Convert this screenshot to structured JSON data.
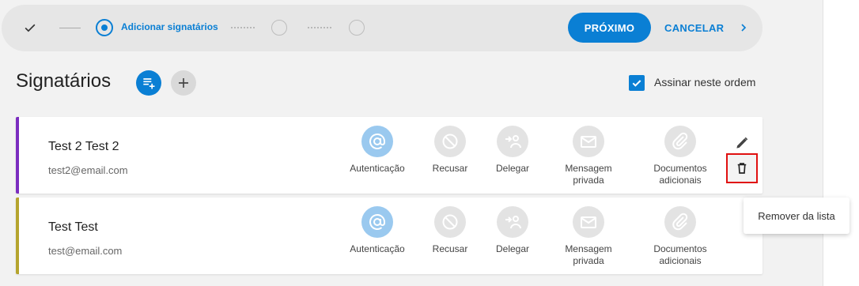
{
  "stepper": {
    "current_step_label": "Adicionar signatários",
    "next_label": "PRÓXIMO",
    "cancel_label": "CANCELAR"
  },
  "section": {
    "title": "Signatários",
    "sign_in_order_label": "Assinar neste ordem",
    "sign_in_order_checked": true
  },
  "signers": [
    {
      "name": "Test 2 Test 2",
      "email": "test2@email.com",
      "accent_color": "#7b2dbf",
      "actions": [
        {
          "label": "Autenticação",
          "icon": "at-icon",
          "active": true
        },
        {
          "label": "Recusar",
          "icon": "block-icon",
          "active": false
        },
        {
          "label": "Delegar",
          "icon": "delegate-icon",
          "active": false
        },
        {
          "label": "Mensagem privada",
          "icon": "mail-icon",
          "active": false
        },
        {
          "label": "Documentos adicionais",
          "icon": "paperclip-icon",
          "active": false
        }
      ]
    },
    {
      "name": "Test Test",
      "email": "test@email.com",
      "accent_color": "#b5a42e",
      "actions": [
        {
          "label": "Autenticação",
          "icon": "at-icon",
          "active": true
        },
        {
          "label": "Recusar",
          "icon": "block-icon",
          "active": false
        },
        {
          "label": "Delegar",
          "icon": "delegate-icon",
          "active": false
        },
        {
          "label": "Mensagem privada",
          "icon": "mail-icon",
          "active": false
        },
        {
          "label": "Documentos adicionais",
          "icon": "paperclip-icon",
          "active": false
        }
      ]
    }
  ],
  "tooltip": {
    "text": "Remover da lista"
  },
  "colors": {
    "primary": "#0a7fd4",
    "highlight_border": "#e01010"
  }
}
